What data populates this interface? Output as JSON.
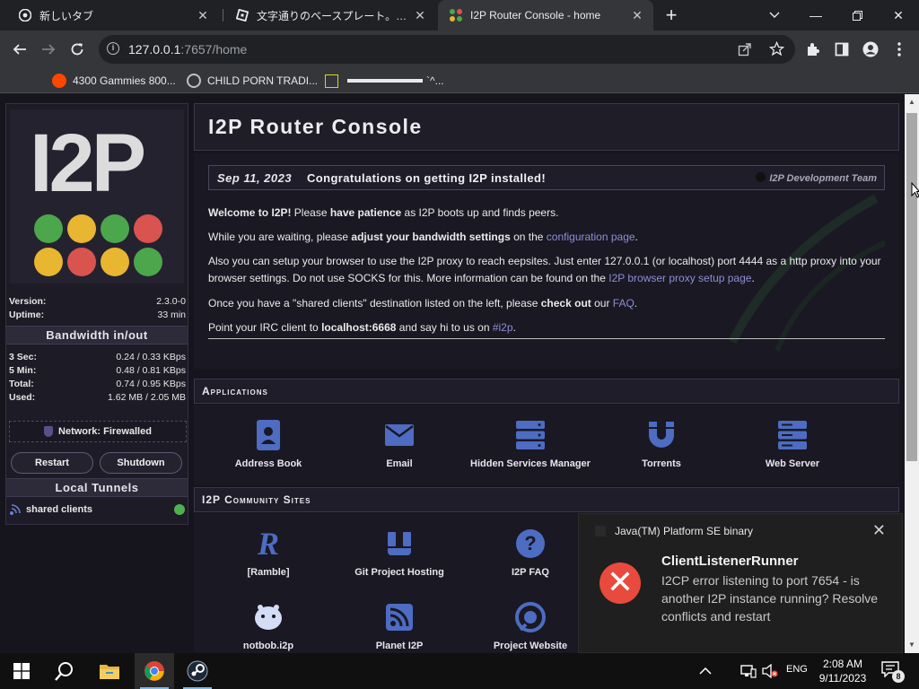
{
  "tabs": [
    {
      "title": "新しいタブ",
      "active": false
    },
    {
      "title": "文字通りのベースプレート。- Roblox",
      "active": false
    },
    {
      "title": "I2P Router Console - home",
      "active": true
    }
  ],
  "toolbar": {
    "url_host": "127.0.0.1",
    "url_rest": ":7657/home"
  },
  "bookmarks": [
    {
      "label": "4300 Gammies 800..."
    },
    {
      "label": "CHILD PORN TRADI..."
    },
    {
      "label": "`^..."
    }
  ],
  "sidebar": {
    "logo_text": "I2P",
    "version_label": "Version:",
    "version_value": "2.3.0-0",
    "uptime_label": "Uptime:",
    "uptime_value": "33 min",
    "bandwidth_title": "Bandwidth in/out",
    "bandwidth": [
      {
        "label": "3 Sec:",
        "value": "0.24 / 0.33 KBps"
      },
      {
        "label": "5 Min:",
        "value": "0.48 / 0.81 KBps"
      },
      {
        "label": "Total:",
        "value": "0.74 / 0.95 KBps"
      },
      {
        "label": "Used:",
        "value": "1.62 MB / 2.05 MB"
      }
    ],
    "network_status": "Network: Firewalled",
    "restart_label": "Restart",
    "shutdown_label": "Shutdown",
    "tunnels_title": "Local Tunnels",
    "tunnel_name": "shared clients"
  },
  "main": {
    "title": "I2P Router Console",
    "news": {
      "date": "Sep 11, 2023",
      "headline": "Congratulations on getting I2P installed!",
      "author": "I2P Development Team",
      "p1": {
        "b1": "Welcome to I2P!",
        "t1": " Please ",
        "b2": "have patience",
        "t2": " as I2P boots up and finds peers."
      },
      "p2": {
        "t1": "While you are waiting, please ",
        "b1": "adjust your bandwidth settings",
        "t2": " on the ",
        "a1": "configuration page",
        "t3": "."
      },
      "p3": {
        "t1": "Also you can setup your browser to use the I2P proxy to reach eepsites. Just enter 127.0.0.1 (or localhost) port 4444 as a http proxy into your browser settings. Do not use SOCKS for this. More information can be found on the ",
        "a1": "I2P browser proxy setup page",
        "t2": "."
      },
      "p4": {
        "t1": "Once you have a \"shared clients\" destination listed on the left, please ",
        "b1": "check out",
        "t2": " our ",
        "a1": "FAQ",
        "t3": "."
      },
      "p5": {
        "t1": "Point your IRC client to ",
        "b1": "localhost:6668",
        "t2": " and say hi to us on ",
        "a1": "#i2p",
        "t3": "."
      }
    },
    "applications_title": "Applications",
    "applications": [
      {
        "label": "Address Book",
        "icon": "address-book-icon"
      },
      {
        "label": "Email",
        "icon": "email-icon"
      },
      {
        "label": "Hidden Services Manager",
        "icon": "server-stack-icon"
      },
      {
        "label": "Torrents",
        "icon": "magnet-icon"
      },
      {
        "label": "Web Server",
        "icon": "web-server-icon"
      }
    ],
    "community_title": "I2P Community Sites",
    "community": [
      {
        "label": "[Ramble]",
        "icon": "ramble-icon"
      },
      {
        "label": "Git Project Hosting",
        "icon": "git-icon"
      },
      {
        "label": "I2P FAQ",
        "icon": "question-icon"
      },
      {
        "label": "notbob.i2p",
        "icon": "ghost-icon"
      },
      {
        "label": "Planet I2P",
        "icon": "rss-icon"
      },
      {
        "label": "Project Website",
        "icon": "i2p-site-icon"
      }
    ]
  },
  "toast": {
    "app": "Java(TM) Platform SE binary",
    "heading": "ClientListenerRunner",
    "message": "I2CP error listening to port 7654 - is another I2P instance running? Resolve conflicts and restart"
  },
  "taskbar": {
    "lang": "ENG",
    "time": "2:08 AM",
    "date": "9/11/2023",
    "notifications": "8"
  },
  "colors": {
    "accent_link": "#8d8ed6",
    "dot_green": "#4ca64c",
    "dot_yellow": "#e8b631",
    "dot_red": "#d9534f",
    "toast_error": "#e84a3d"
  }
}
